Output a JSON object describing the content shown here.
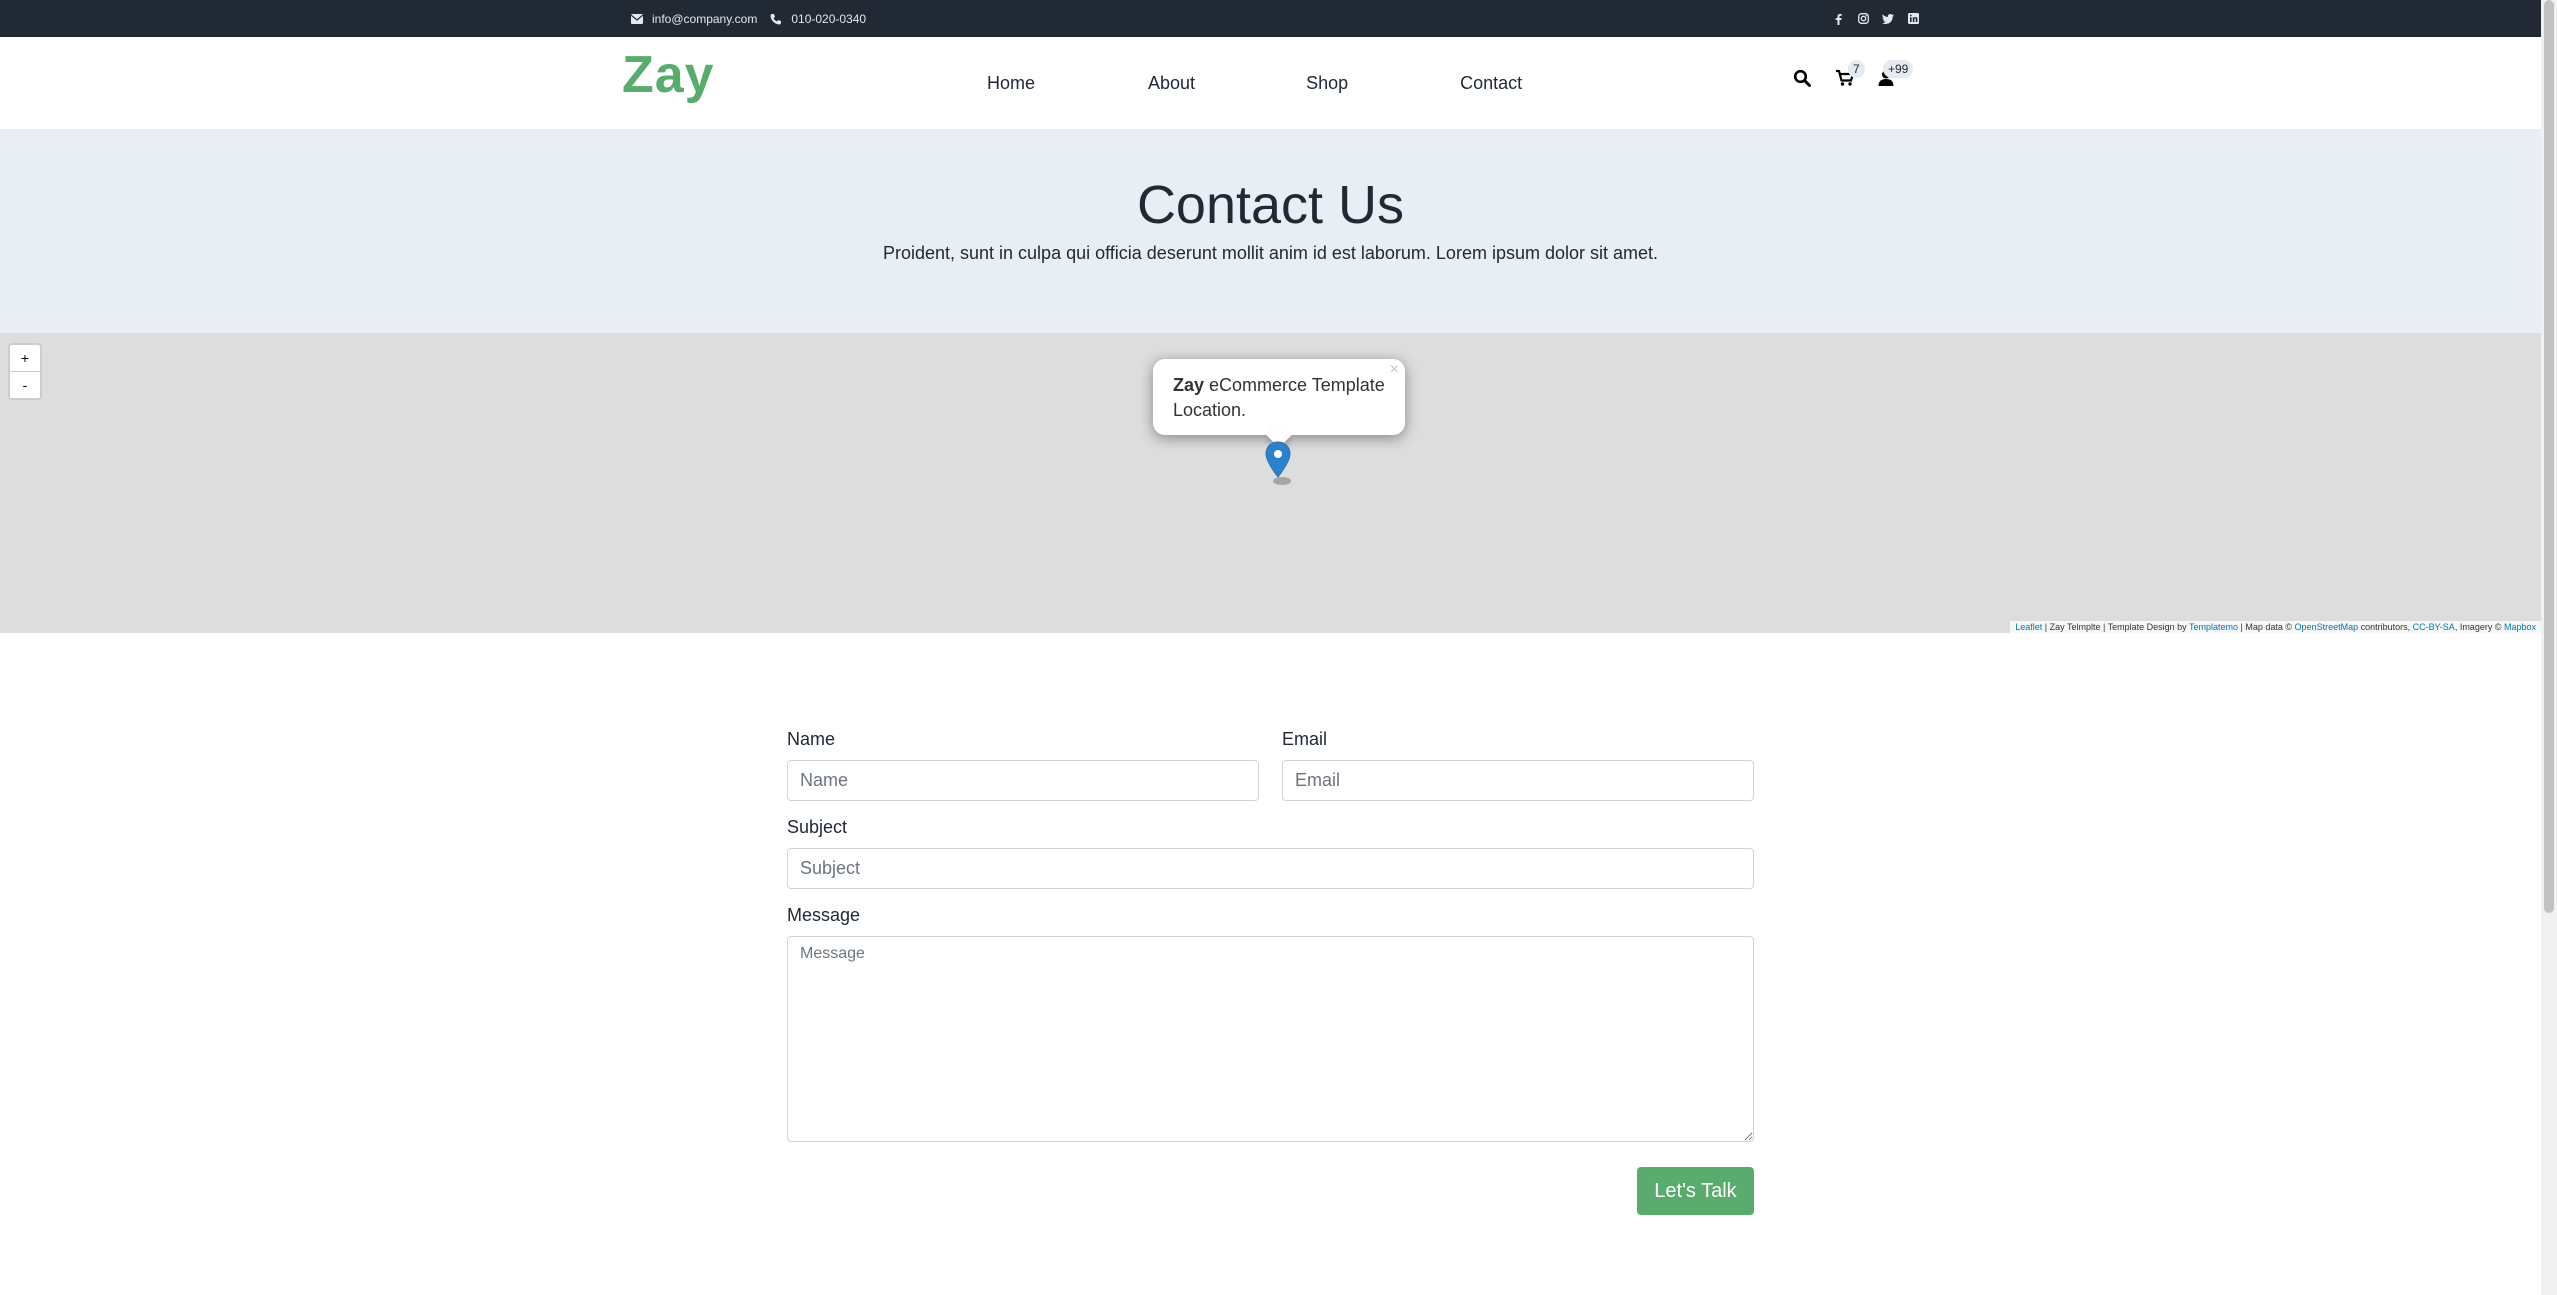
{
  "topbar": {
    "email": "info@company.com",
    "phone": "010-020-0340",
    "social": [
      "facebook-icon",
      "instagram-icon",
      "twitter-icon",
      "linkedin-icon"
    ]
  },
  "nav": {
    "logo": "Zay",
    "items": [
      "Home",
      "About",
      "Shop",
      "Contact"
    ],
    "cart_count": "7",
    "user_count": "+99"
  },
  "banner": {
    "title": "Contact Us",
    "subtitle": "Proident, sunt in culpa qui officia deserunt mollit anim id est laborum. Lorem ipsum dolor sit amet."
  },
  "map": {
    "zoom_in": "+",
    "zoom_out": "-",
    "popup_bold": "Zay",
    "popup_text": " eCommerce Template Location.",
    "popup_close": "×",
    "attribution": {
      "leaflet": "Leaflet",
      "middle1": " | Zay Telmplte | Template Design by ",
      "templatemo": "Templatemo",
      "middle2": " | Map data © ",
      "osm": "OpenStreetMap",
      "middle3": " contributors, ",
      "ccbysa": "CC-BY-SA",
      "middle4": ", Imagery © ",
      "mapbox": "Mapbox"
    }
  },
  "form": {
    "name_label": "Name",
    "name_placeholder": "Name",
    "email_label": "Email",
    "email_placeholder": "Email",
    "subject_label": "Subject",
    "subject_placeholder": "Subject",
    "message_label": "Message",
    "message_placeholder": "Message",
    "submit_label": "Let's Talk"
  },
  "colors": {
    "brand_green": "#59ab6e",
    "topbar_bg": "#212934",
    "banner_bg": "#e9eef5"
  }
}
